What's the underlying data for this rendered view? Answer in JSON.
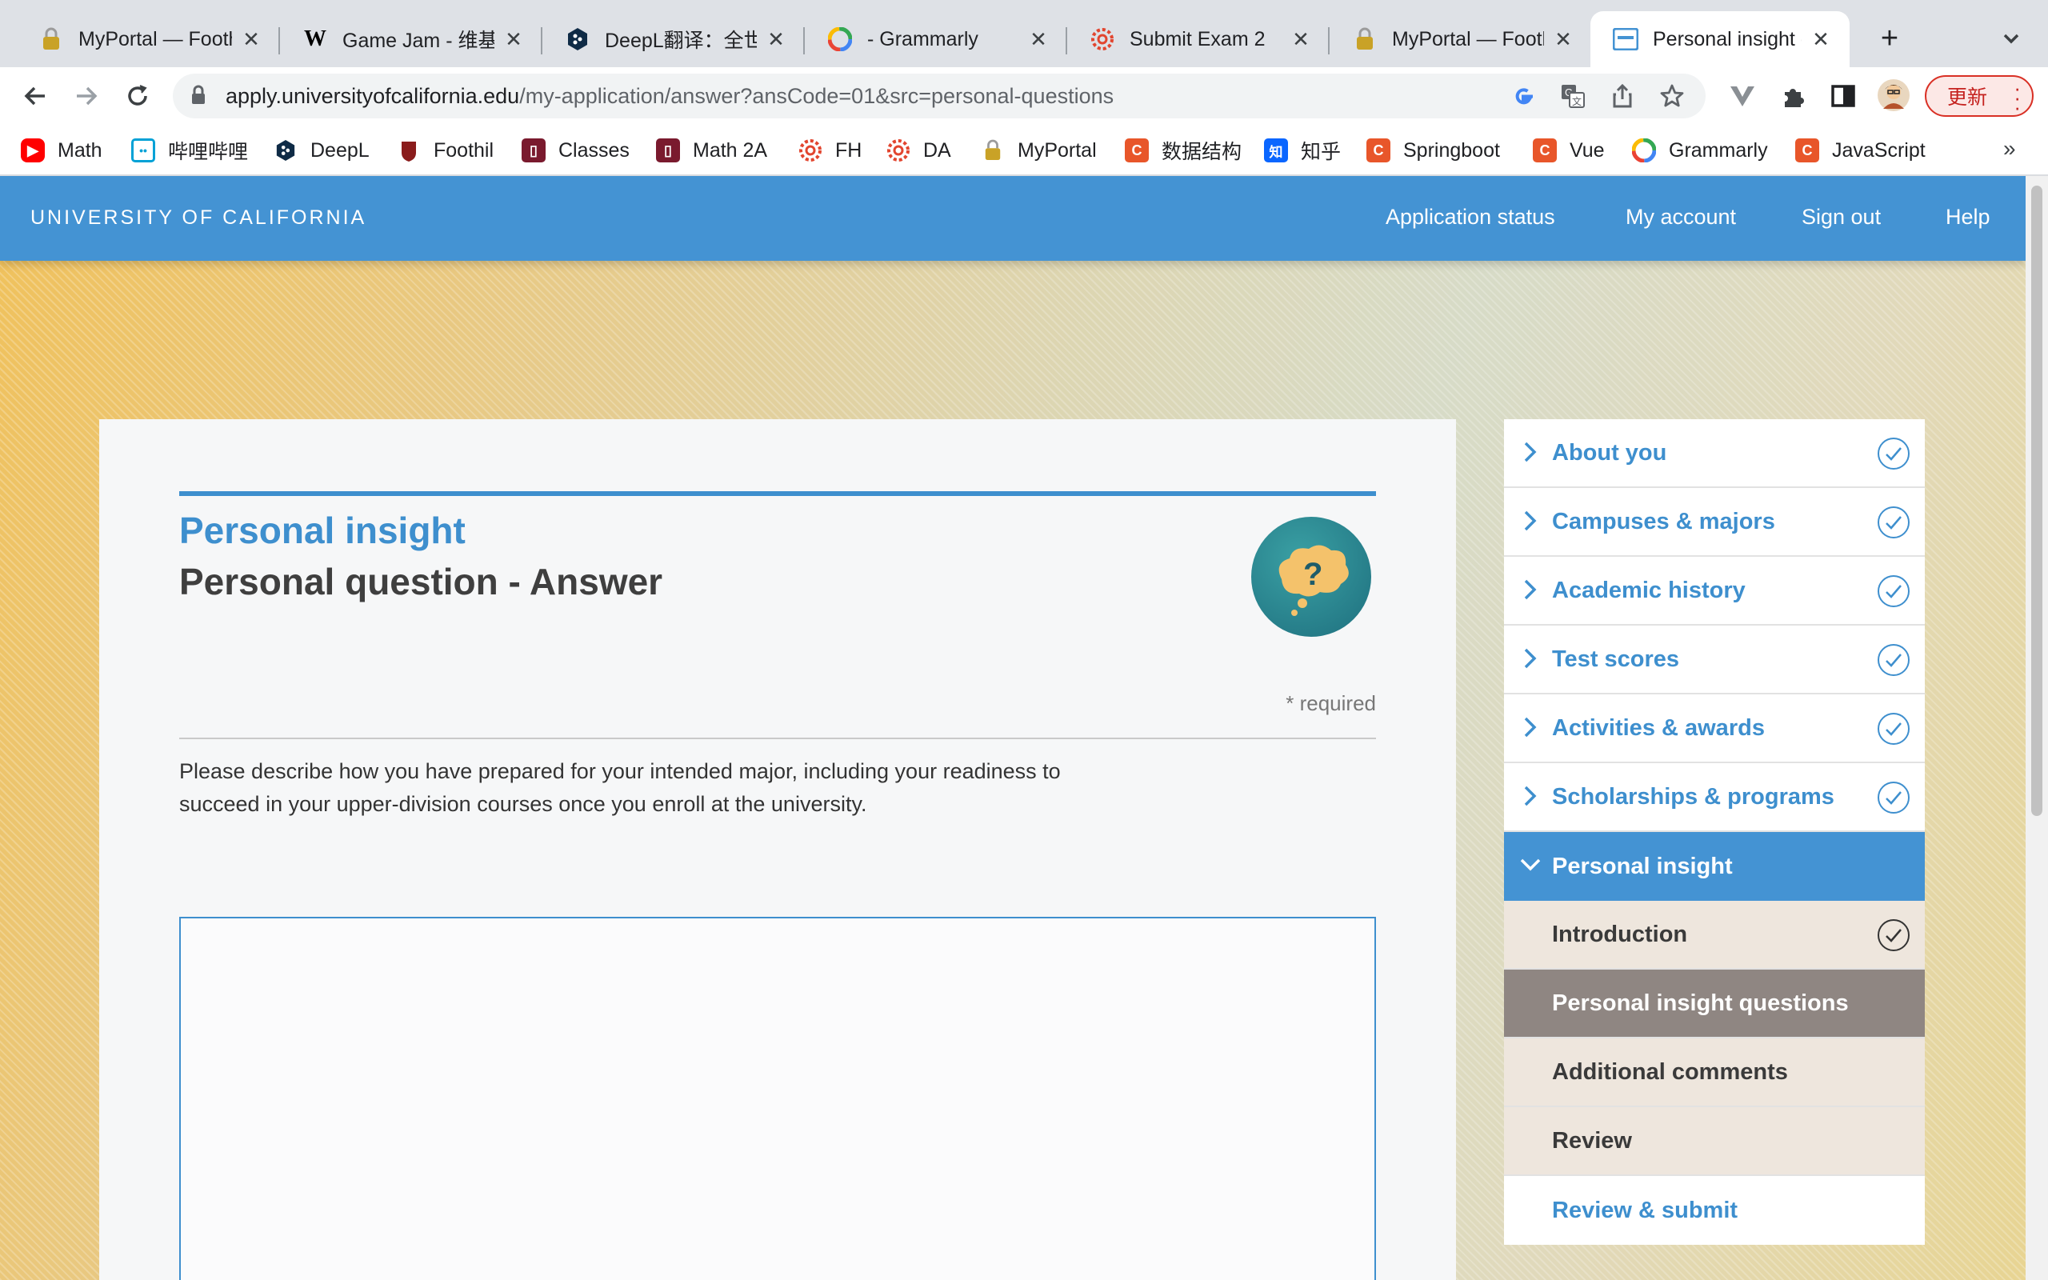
{
  "browser": {
    "tabs": [
      {
        "title": "MyPortal — Footh",
        "icon": "lock-icon",
        "active": false
      },
      {
        "title": "Game Jam - 维基百",
        "icon": "wikipedia-icon",
        "active": false
      },
      {
        "title": "DeepL翻译：全世界",
        "icon": "deepl-icon",
        "active": false
      },
      {
        "title": "- Grammarly",
        "icon": "grammarly-icon",
        "active": false
      },
      {
        "title": "Submit Exam 2",
        "icon": "canvas-icon",
        "active": false
      },
      {
        "title": "MyPortal — Footh",
        "icon": "lock-icon",
        "active": false
      },
      {
        "title": "Personal insight q",
        "icon": "uc-app-icon",
        "active": true
      }
    ],
    "url_host": "apply.universityofcalifornia.edu",
    "url_path": "/my-application/answer?ansCode=01&src=personal-questions",
    "update_label": "更新",
    "bookmarks": [
      {
        "label": "Math",
        "icon": "youtube-icon",
        "color": "#ff0000"
      },
      {
        "label": "哔哩哔哩",
        "icon": "bilibili-icon",
        "color": "#00a1d6"
      },
      {
        "label": "DeepL",
        "icon": "deepl-icon",
        "color": "#0f2b46"
      },
      {
        "label": "Foothil",
        "icon": "foothill-icon",
        "color": "#8a1c1c"
      },
      {
        "label": "Classes",
        "icon": "book-icon",
        "color": "#7a1a2e"
      },
      {
        "label": "Math 2A",
        "icon": "book-icon",
        "color": "#7a1a2e"
      },
      {
        "label": "FH",
        "icon": "canvas-icon",
        "color": "#e2452f"
      },
      {
        "label": "DA",
        "icon": "canvas-icon",
        "color": "#e2452f"
      },
      {
        "label": "MyPortal",
        "icon": "lock-icon",
        "color": "#b8860b"
      },
      {
        "label": "数据结构",
        "icon": "c-icon",
        "color": "#e8562a"
      },
      {
        "label": "知乎",
        "icon": "zhihu-icon",
        "color": "#0a66ff"
      },
      {
        "label": "Springboot",
        "icon": "c-icon",
        "color": "#e8562a"
      },
      {
        "label": "Vue",
        "icon": "c-icon",
        "color": "#e8562a"
      },
      {
        "label": "Grammarly",
        "icon": "grammarly-icon",
        "color": "#15c39a"
      },
      {
        "label": "JavaScript",
        "icon": "c-icon",
        "color": "#e8562a"
      }
    ],
    "bookmarks_more": "»"
  },
  "site": {
    "logo": "UNIVERSITY OF CALIFORNIA",
    "nav": [
      "Application status",
      "My account",
      "Sign out",
      "Help"
    ],
    "brand_color": "#4493d3"
  },
  "main": {
    "section_title": "Personal insight",
    "page_title": "Personal question - Answer",
    "required_note": "* required",
    "prompt": "Please describe how you have prepared for your intended major, including your readiness to succeed in your upper-division courses once you enroll at the university.",
    "answer_value": ""
  },
  "sidebar": {
    "items": [
      {
        "label": "About you",
        "complete": true
      },
      {
        "label": "Campuses & majors",
        "complete": true
      },
      {
        "label": "Academic history",
        "complete": true
      },
      {
        "label": "Test scores",
        "complete": true
      },
      {
        "label": "Activities & awards",
        "complete": true
      },
      {
        "label": "Scholarships & programs",
        "complete": true
      },
      {
        "label": "Personal insight",
        "expanded": true
      }
    ],
    "subitems": [
      {
        "label": "Introduction",
        "complete": true
      },
      {
        "label": "Personal insight questions",
        "current": true
      },
      {
        "label": "Additional comments"
      },
      {
        "label": "Review"
      }
    ],
    "final_item": "Review & submit"
  }
}
